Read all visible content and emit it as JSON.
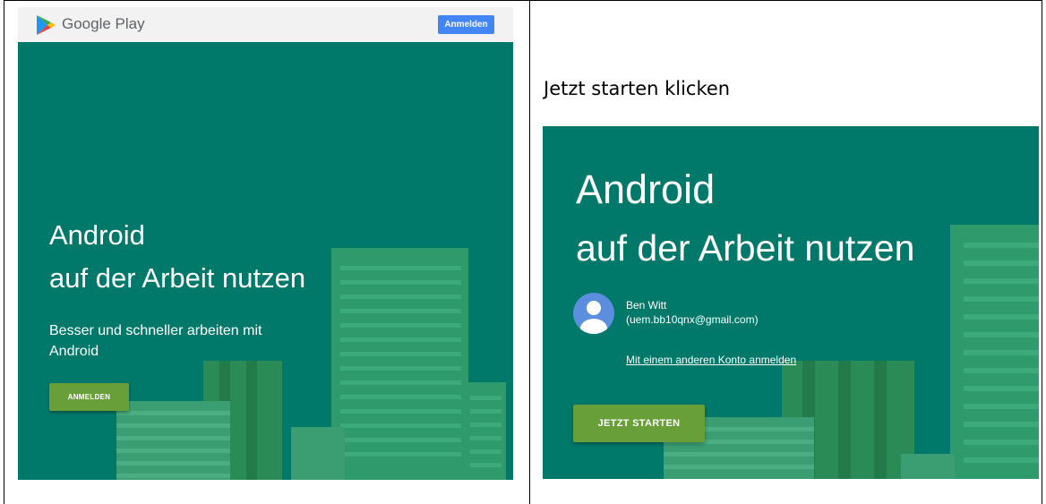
{
  "left_panel": {
    "header": {
      "brand": "Google Play",
      "signin_label": "Anmelden",
      "icon": "google-play-icon"
    },
    "hero": {
      "title_line1": "Android",
      "title_line2": "auf der Arbeit nutzen",
      "subtitle": "Besser und schneller arbeiten mit Android",
      "button_label": "ANMELDEN"
    },
    "colors": {
      "background": "#00786a",
      "button": "#689f38",
      "header_button": "#4285f4"
    }
  },
  "right_panel": {
    "instruction": "Jetzt starten klicken",
    "hero": {
      "title_line1": "Android",
      "title_line2": "auf der Arbeit nutzen",
      "account_name": "Ben Witt",
      "account_email": "(uem.bb10qnx@gmail.com)",
      "other_account_link": "Mit einem anderen Konto anmelden",
      "button_label": "JETZT STARTEN"
    }
  }
}
